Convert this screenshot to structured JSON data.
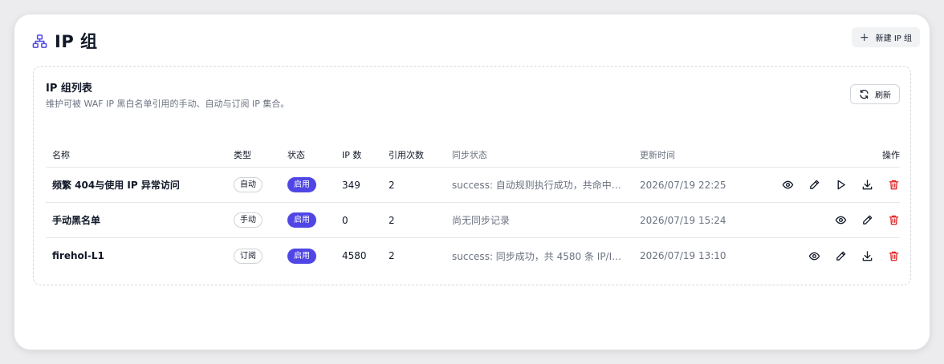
{
  "header": {
    "title": "IP 组",
    "icon": "network-icon",
    "new_button_label": "新建 IP 组"
  },
  "panel": {
    "title": "IP 组列表",
    "description": "维护可被 WAF IP 黑白名单引用的手动、自动与订阅 IP 集合。",
    "refresh_label": "刷新"
  },
  "table": {
    "columns": [
      "名称",
      "类型",
      "状态",
      "IP 数",
      "引用次数",
      "同步状态",
      "更新时间",
      "操作"
    ],
    "rows": [
      {
        "name": "频繁 404与使用 IP 异常访问",
        "type": "自动",
        "status": "启用",
        "ip_count": "349",
        "refs": "2",
        "sync": "success: 自动规则执行成功，共命中…",
        "updated": "2026/07/19 22:25"
      },
      {
        "name": "手动黑名单",
        "type": "手动",
        "status": "启用",
        "ip_count": "0",
        "refs": "2",
        "sync": "尚无同步记录",
        "updated": "2026/07/19 15:24"
      },
      {
        "name": "firehol-L1",
        "type": "订阅",
        "status": "启用",
        "ip_count": "4580",
        "refs": "2",
        "sync": "success: 同步成功，共 4580 条 IP/I…",
        "updated": "2026/07/19 13:10"
      }
    ]
  },
  "colors": {
    "accent": "#4f46e5",
    "danger": "#dc2626",
    "muted": "#6b7280"
  }
}
